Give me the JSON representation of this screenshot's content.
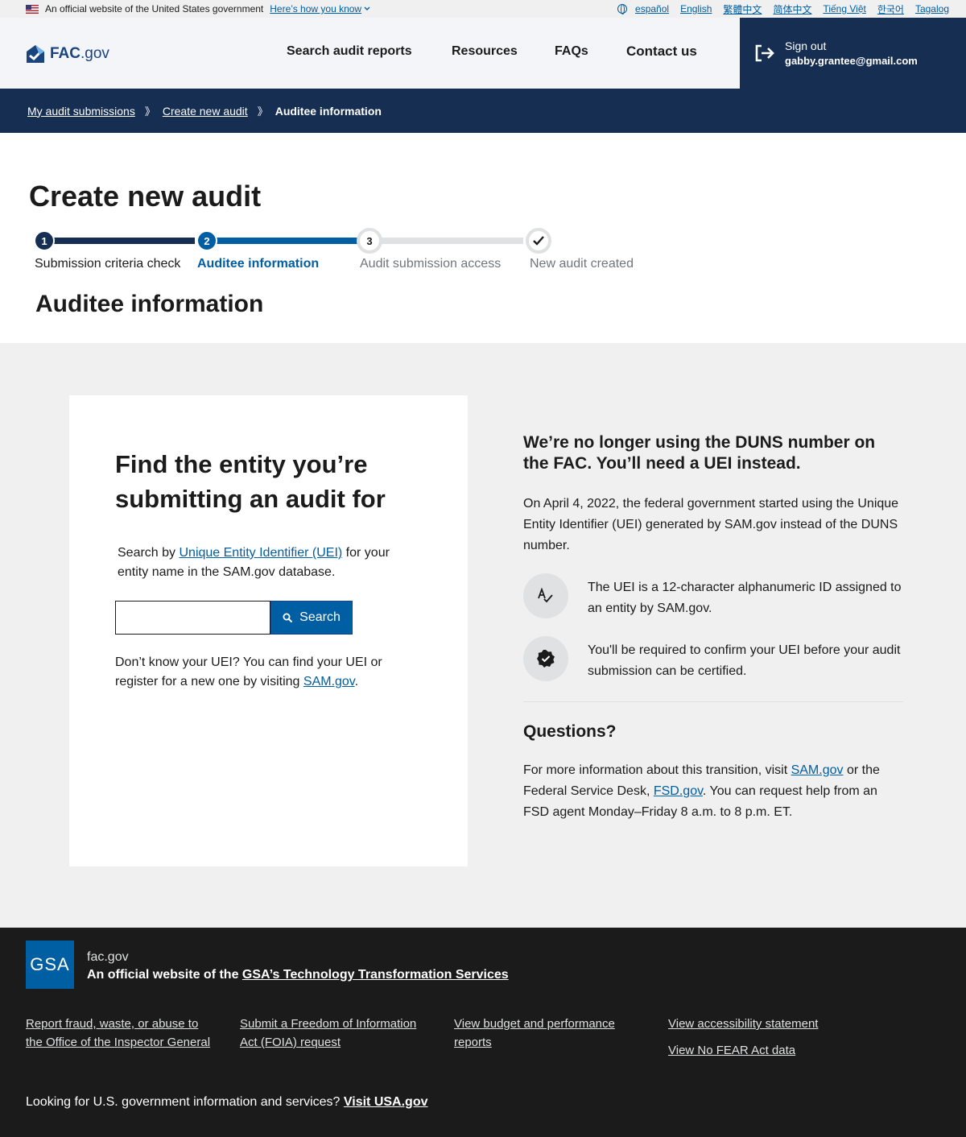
{
  "gov_banner": {
    "official_text": "An official website of the United States government",
    "how_link": "Here’s how you know",
    "languages": [
      "español",
      "English",
      "繁體中文",
      "简体中文",
      "Tiếng Việt",
      "한국어",
      "Tagalog"
    ]
  },
  "header": {
    "logo_bold": "FAC",
    "logo_rest": ".gov",
    "nav": [
      "Search audit reports",
      "Resources",
      "FAQs",
      "Contact us"
    ],
    "sign_out_label": "Sign out",
    "user_email": "gabby.grantee@gmail.com"
  },
  "breadcrumb": {
    "items": [
      "My audit submissions",
      "Create new audit"
    ],
    "current": "Auditee information",
    "separator": "》"
  },
  "page": {
    "title": "Create new audit",
    "section_title": "Auditee information"
  },
  "steps": [
    {
      "number": "1",
      "label": "Submission criteria check",
      "status": "complete"
    },
    {
      "number": "2",
      "label": "Auditee information",
      "status": "current"
    },
    {
      "number": "3",
      "label": "Audit submission access",
      "status": "upcoming"
    },
    {
      "number": "",
      "label": "New audit created",
      "status": "upcoming-check"
    }
  ],
  "search_card": {
    "title": "Find the entity you’re submitting an audit for",
    "desc_before": "Search by ",
    "desc_link": "Unique Entity Identifier (UEI)",
    "desc_after": " for your entity name in the SAM.gov database.",
    "input_value": "",
    "button_label": "Search",
    "help_before": "Don’t know your UEI? You can find your UEI or register for a new one by visiting ",
    "help_link": "SAM.gov",
    "help_after": "."
  },
  "info": {
    "title": "We’re no longer using the DUNS number on the FAC. You’ll need a UEI instead.",
    "body": "On April 4, 2022, the federal government started using the Unique Entity Identifier (UEI) generated by SAM.gov instead of the DUNS number.",
    "features": [
      {
        "icon": "spellcheck-icon",
        "text": "The UEI is a 12-character alphanumeric ID assigned to an entity by SAM.gov."
      },
      {
        "icon": "verified-badge-icon",
        "text": "You'll be required to confirm your UEI before your audit submission can be certified."
      }
    ],
    "questions_title": "Questions?",
    "q_before": "For more information about this transition, visit ",
    "q_link1": "SAM.gov",
    "q_mid": " or the Federal Service Desk, ",
    "q_link2": "FSD.gov",
    "q_after": ". You can request help from an FSD agent Monday–Friday 8 a.m. to 8 p.m. ET."
  },
  "footer": {
    "logo_text": "GSA",
    "site": "fac.gov",
    "official_prefix": "An official website of the ",
    "official_link": "GSA’s Technology Transformation Services",
    "links": [
      "Report fraud, waste, or abuse to the Office of the Inspector General",
      "Submit a Freedom of Information Act (FOIA) request",
      "View budget and performance reports",
      "View accessibility statement",
      "View No FEAR Act data"
    ],
    "usa_text": "Looking for U.S. government information and services? ",
    "usa_link": "Visit USA.gov"
  },
  "colors": {
    "primary": "#005ea2",
    "navy": "#162e51",
    "gray_bg": "#f0f0f0",
    "footer_bg": "#1b1b1b"
  }
}
